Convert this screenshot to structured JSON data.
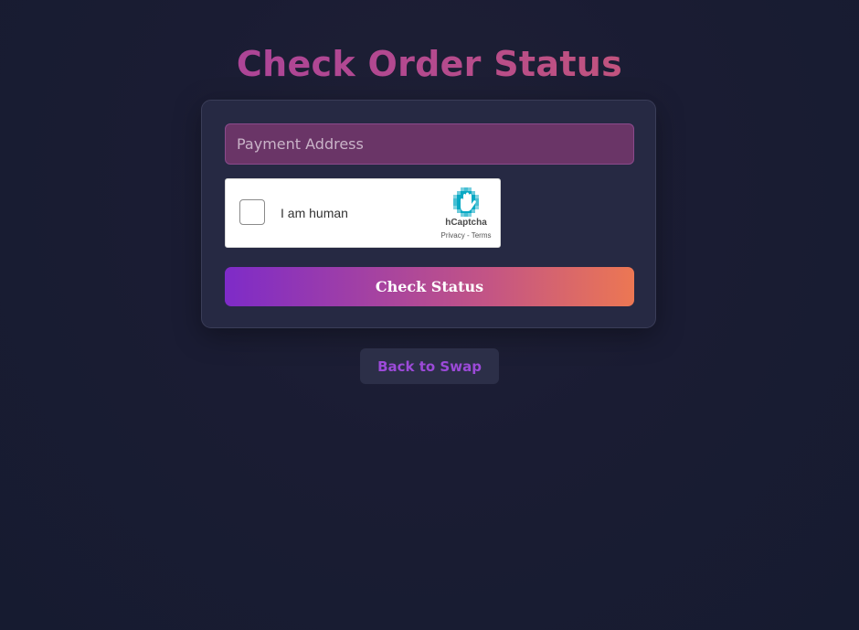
{
  "page": {
    "title": "Check Order Status"
  },
  "form": {
    "address_placeholder": "Payment Address",
    "address_value": ""
  },
  "captcha": {
    "label": "I am human",
    "brand": "hCaptcha",
    "privacy_label": "Privacy",
    "separator": " - ",
    "terms_label": "Terms",
    "logo_icon": "hcaptcha-hand-icon"
  },
  "actions": {
    "check_label": "Check Status",
    "back_label": "Back to Swap"
  },
  "colors": {
    "accent_purple": "#9c4ad8",
    "gradient_start": "#7e2bc8",
    "gradient_end": "#ec7753",
    "input_bg": "#6a3567",
    "card_bg": "#262943",
    "page_bg": "#1a1c33"
  }
}
